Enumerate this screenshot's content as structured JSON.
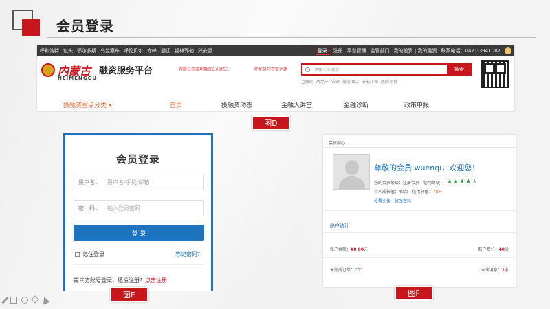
{
  "slide": {
    "title": "会员登录"
  },
  "figD": {
    "label": "图D",
    "topbar": {
      "cities": [
        "呼和浩特",
        "包头",
        "鄂尔多斯",
        "乌兰察布",
        "呼伦贝尔",
        "赤峰",
        "通辽",
        "锡林郭勒",
        "兴安盟"
      ],
      "login": "登录",
      "register": "注册",
      "platform_manage": "平台管理",
      "supervision": "监管部门",
      "my_investment": "我的投资 | 我的融资",
      "contact": "联系电话：0471-3941087"
    },
    "brand": {
      "cn": "内蒙古",
      "en": "NEIMENGGU",
      "platform": "融资服务平台"
    },
    "ticker1": "有限公司成功融资6.00亿元",
    "ticker2": "呼伦贝尔市安达建",
    "search": {
      "placeholder": "请输入关键字",
      "button": "搜索",
      "hot_words": [
        "互联网",
        "房地产",
        "农业",
        "旅游酒店",
        "节能环保",
        "医院项目"
      ]
    },
    "nav": {
      "category": "投融资重点分类",
      "home": "首页",
      "news": "投融资动态",
      "lecture": "金融大讲堂",
      "diagnosis": "金融诊断",
      "policy": "政策申报"
    }
  },
  "figE": {
    "label": "图E",
    "title": "会员登录",
    "username_label": "用户名：",
    "username_placeholder": "用户名/手机/邮箱",
    "password_label": "密　码：",
    "password_placeholder": "输入登录密码",
    "login_button": "登 录",
    "remember": "记住登录",
    "forgot": "忘记密码？",
    "third_party_text": "第三方账号登录，还没注册？",
    "register_link": "点击注册"
  },
  "figF": {
    "label": "图F",
    "header": "会员中心",
    "welcome": "尊敬的会员 wuenqi，欢迎您！",
    "level_text": "您的会员等级：注册会员　信用等级：",
    "stars_on": "★★★★",
    "stars_off": "★",
    "growth_text": "个人成长值：40点　信用分值：",
    "credit_score": "78分",
    "set_avatar": "设置头像",
    "change_password": "修改密码",
    "account_title": "账户统计",
    "balance_label": "账户余额：",
    "balance_value": "¥0.00",
    "balance_unit": "元",
    "points_label": "账户积分：",
    "points_value": "40",
    "points_unit": "分",
    "orders_label": "未完成订单：",
    "orders_value": "0",
    "orders_unit": "个",
    "messages_label": "未读消息：",
    "messages_value": "1",
    "messages_unit": "条"
  }
}
